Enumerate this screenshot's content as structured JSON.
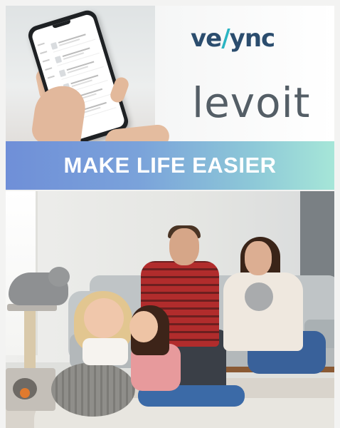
{
  "brand": {
    "vesync_prefix": "ve",
    "vesync_slash": "/",
    "vesync_suffix": "ync",
    "levoit": "levoit"
  },
  "banner": {
    "headline": "MAKE LIFE EASIER"
  },
  "colors": {
    "banner_start": "#6f8fd8",
    "banner_end": "#a6e6d8",
    "vesync_accent": "#2bb5c3",
    "vesync_dark": "#2b4d6e",
    "levoit_grey": "#545e66"
  },
  "icons": {
    "phone": "smartphone-icon"
  }
}
